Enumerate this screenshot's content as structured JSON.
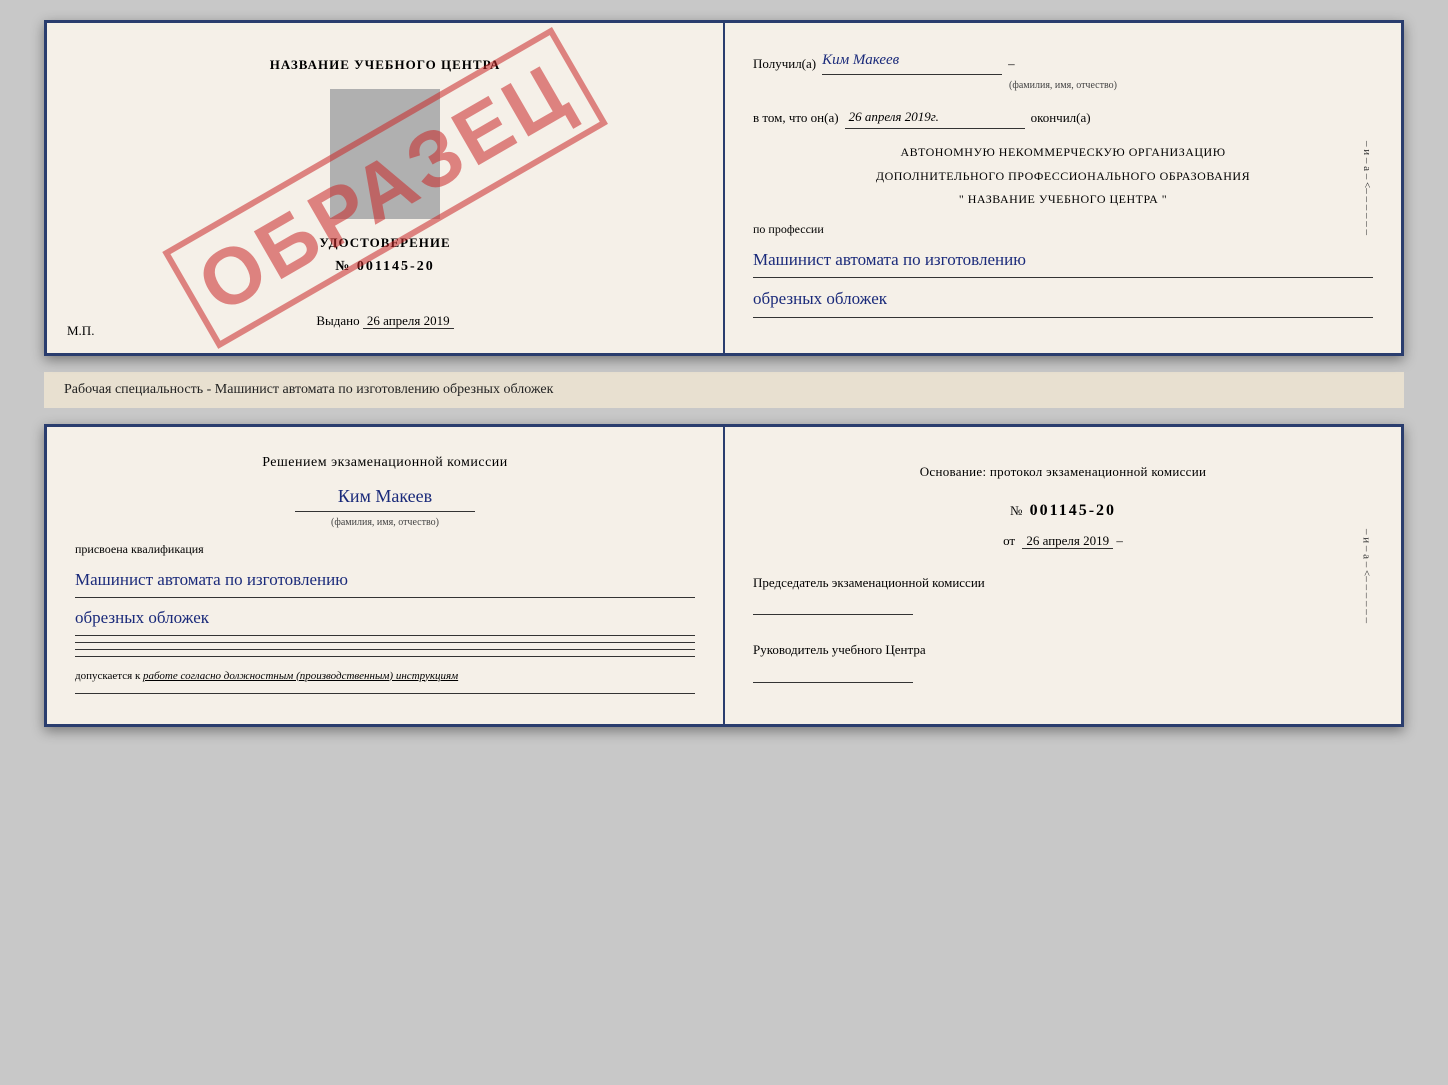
{
  "top_doc": {
    "left": {
      "title": "НАЗВАНИЕ УЧЕБНОГО ЦЕНТРА",
      "udostoverenie": "УДОСТОВЕРЕНИЕ",
      "number": "№ 001145-20",
      "vydano_label": "Выдано",
      "vydano_date": "26 апреля 2019",
      "mp": "М.П.",
      "stamp": "ОБРАЗЕЦ"
    },
    "right": {
      "poluchil_label": "Получил(а)",
      "poluchil_value": "Ким Макеев",
      "poluchil_sub": "(фамилия, имя, отчество)",
      "vtom_label": "в том, что он(а)",
      "vtom_value": "26 апреля 2019г.",
      "okончил_label": "окончил(а)",
      "org_line1": "АВТОНОМНУЮ НЕКОММЕРЧЕСКУЮ ОРГАНИЗАЦИЮ",
      "org_line2": "ДОПОЛНИТЕЛЬНОГО ПРОФЕССИОНАЛЬНОГО ОБРАЗОВАНИЯ",
      "org_line3": "\"  НАЗВАНИЕ УЧЕБНОГО ЦЕНТРА  \"",
      "po_professii": "по профессии",
      "profession_line1": "Машинист автомата по изготовлению",
      "profession_line2": "обрезных обложек"
    }
  },
  "between": {
    "text": "Рабочая специальность - Машинист автомата по изготовлению обрезных обложек"
  },
  "bottom_doc": {
    "left": {
      "resheniem": "Решением экзаменационной комиссии",
      "name": "Ким Макеев",
      "name_sub": "(фамилия, имя, отчество)",
      "prisvoena": "присвоена квалификация",
      "kvali_line1": "Машинист автомата по изготовлению",
      "kvali_line2": "обрезных обложек",
      "dopusk_label": "допускается к",
      "dopusk_value": "работе согласно должностным (производственным) инструкциям"
    },
    "right": {
      "osnovanie": "Основание: протокол экзаменационной комиссии",
      "number_label": "№",
      "number_value": "001145-20",
      "ot_label": "от",
      "ot_value": "26 апреля 2019",
      "predsedatel_label": "Председатель экзаменационной комиссии",
      "rukovoditel_label": "Руководитель учебного Центра"
    }
  }
}
